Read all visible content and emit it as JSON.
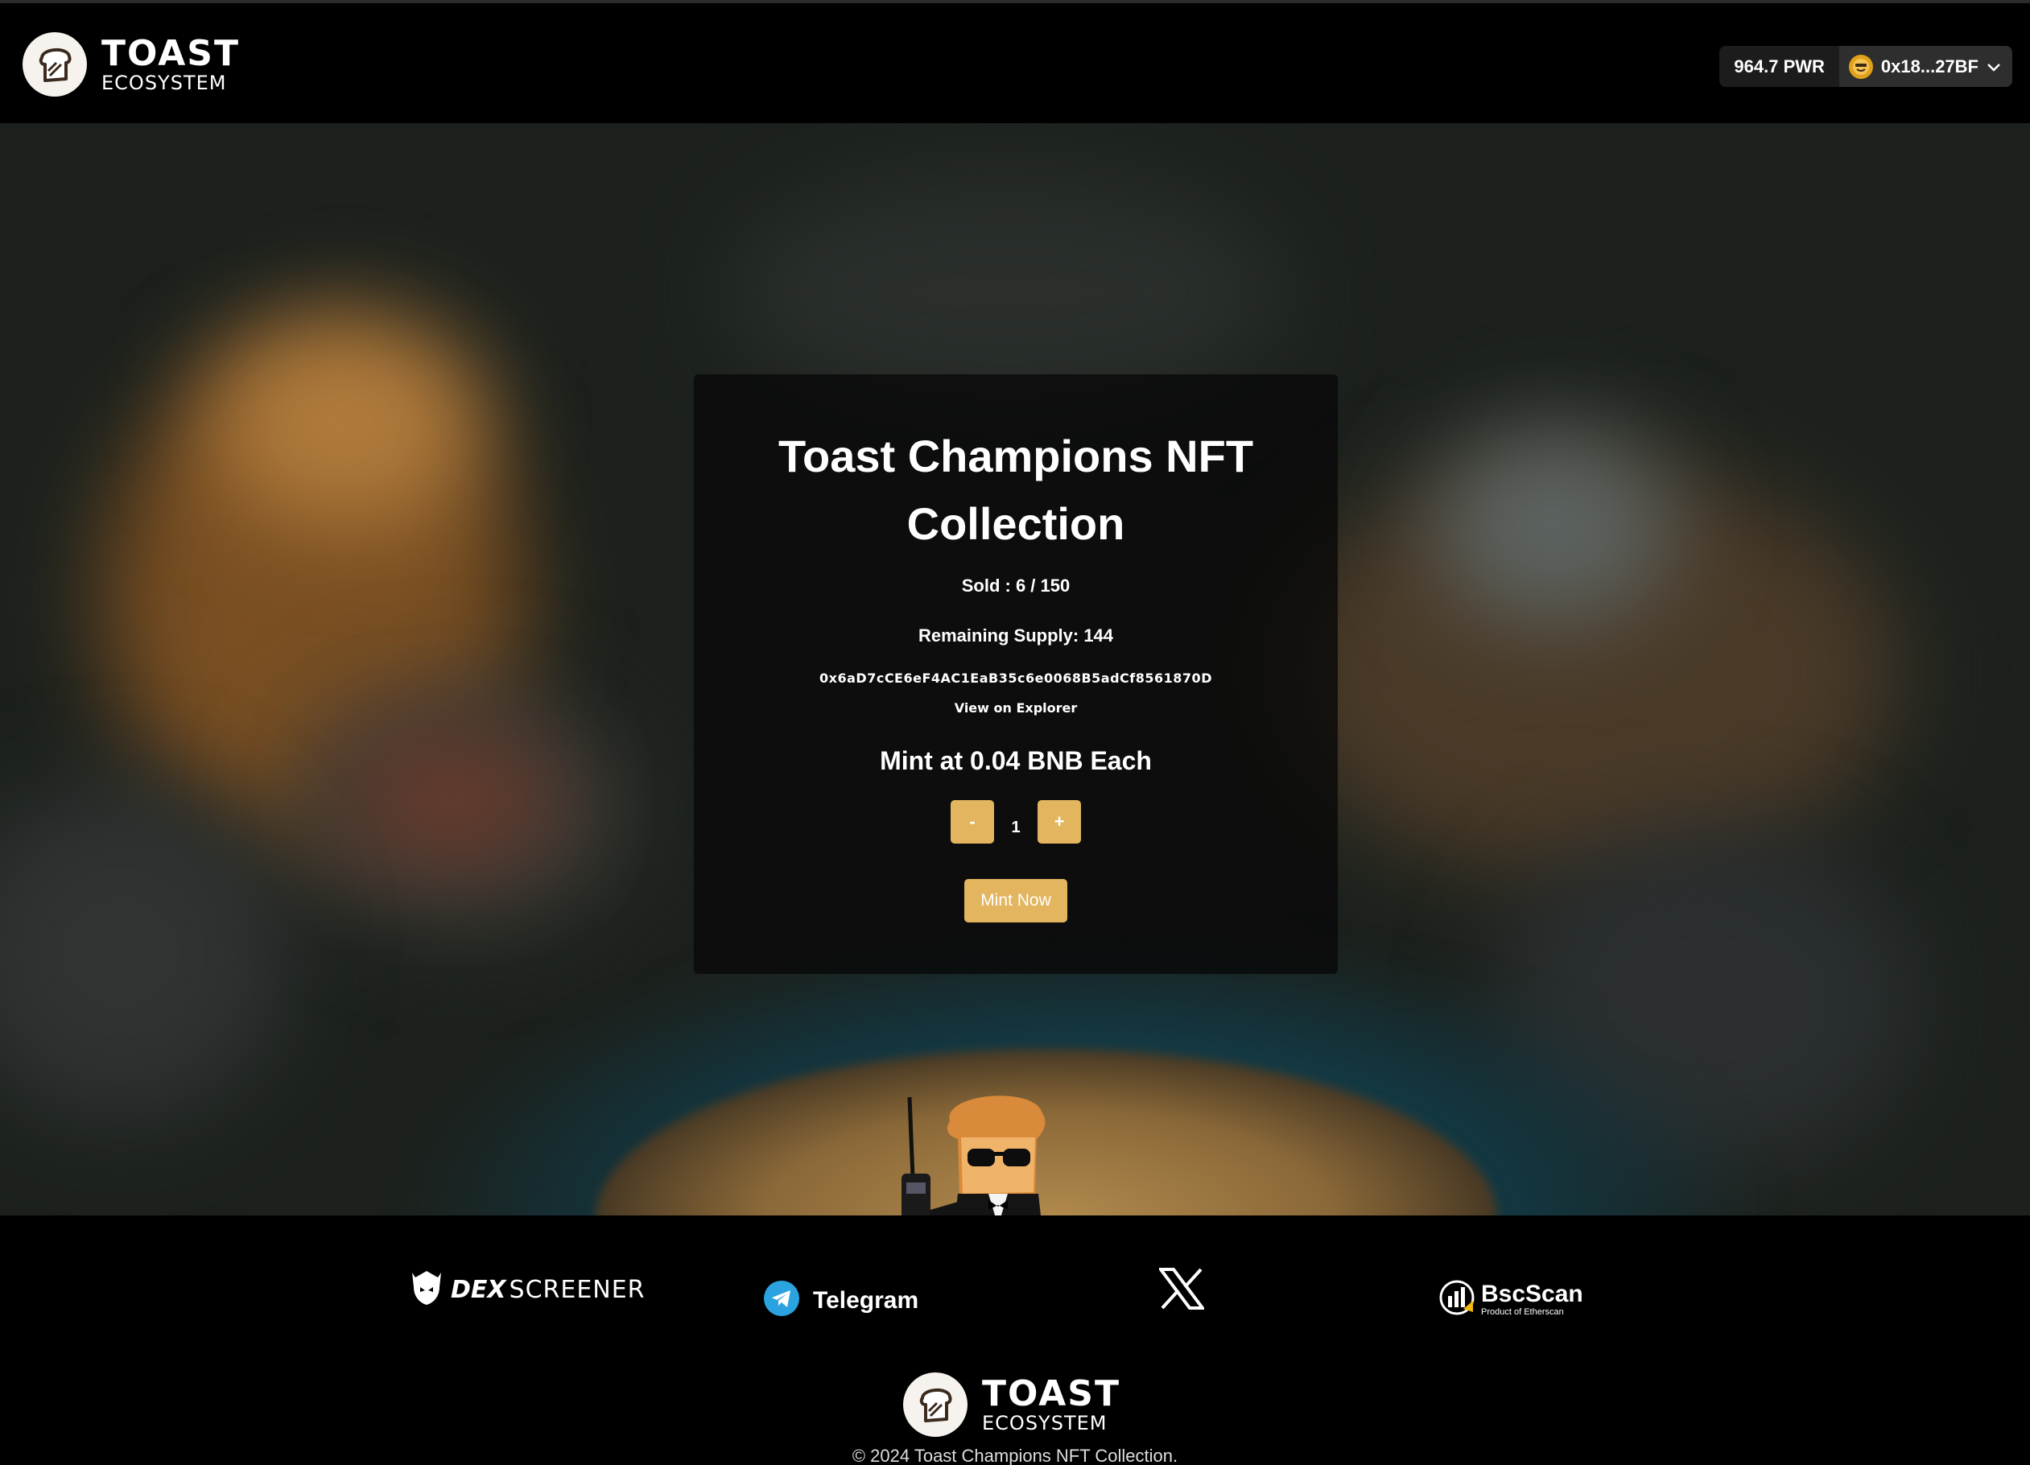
{
  "header": {
    "logo": {
      "line1": "TOAST",
      "line2": "ECOSYSTEM"
    },
    "wallet": {
      "balance": "964.7 PWR",
      "address": "0x18...27BF",
      "avatar_icon": "face-emoji-icon",
      "dropdown_icon": "chevron-down-icon"
    }
  },
  "card": {
    "title": "Toast Champions NFT Collection",
    "sold": "Sold : 6 / 150",
    "remaining": "Remaining Supply: 144",
    "contract_address": "0x6aD7cCE6eF4AC1EaB35c6e0068B5adCf8561870D",
    "explorer_link": "View on Explorer",
    "mint_price": "Mint at 0.04 BNB Each",
    "decrement_label": "-",
    "quantity": "1",
    "increment_label": "+",
    "mint_button": "Mint Now"
  },
  "footer": {
    "links": {
      "dexscreener": {
        "part1": "DEX",
        "part2": "SCREENER",
        "icon": "dexscreener-logo-icon"
      },
      "telegram": {
        "label": "Telegram",
        "icon": "telegram-icon"
      },
      "x": {
        "icon": "x-logo-icon"
      },
      "bscscan": {
        "label": "BscScan",
        "sub": "Product of Etherscan",
        "icon": "bscscan-logo-icon"
      }
    },
    "logo": {
      "line1": "TOAST",
      "line2": "ECOSYSTEM"
    },
    "copyright": "© 2024 Toast Champions NFT Collection."
  },
  "colors": {
    "accent": "#e2b55e",
    "card_bg": "rgba(8,8,8,0.78)",
    "header_bg": "#000000",
    "telegram": "#2aa3e0"
  }
}
